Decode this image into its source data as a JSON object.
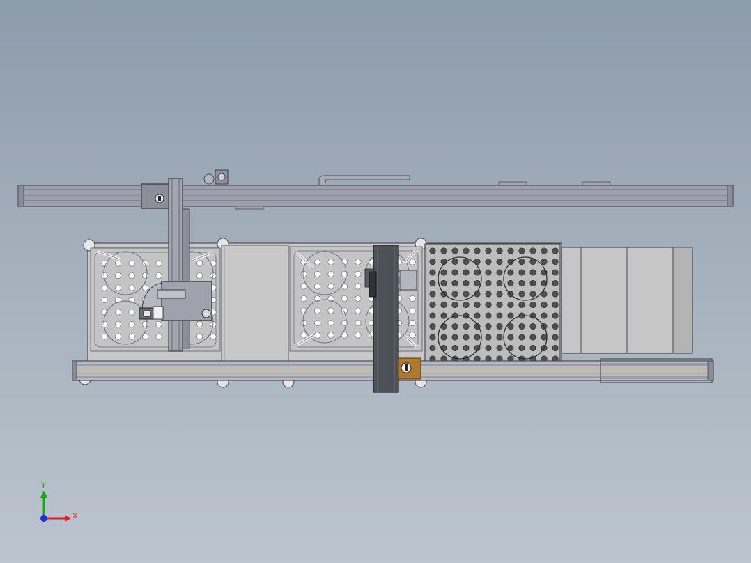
{
  "viewport": {
    "background_top": "#8d9cab",
    "background_bottom": "#bcc5ce"
  },
  "colors": {
    "frame": "#9ea0ad",
    "frame_dark": "#5a5c66",
    "plate": "#c6c6c6",
    "hole": "#ffffff",
    "dense_plate": "#b9b9b9",
    "dense_hole": "#505050",
    "carriage": "#4a4c55",
    "accent_bracket": "#b07a2e",
    "rail_yellow": "#c9c08a"
  },
  "triad": {
    "y_label": "Y",
    "x_label": "X",
    "y_color": "#18a818",
    "x_color": "#e02020",
    "z_color": "#1f2fd0",
    "icon": "axis-triad-icon"
  }
}
